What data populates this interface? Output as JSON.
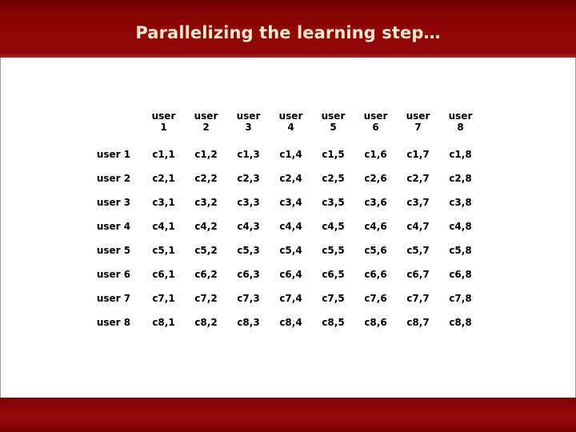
{
  "slide": {
    "title": "Parallelizing the learning step…",
    "title_band_color": "#8b0505",
    "title_text_color": "#fbecd0",
    "body_background": "#ffffff",
    "bottom_band_color": "#8b0505",
    "text_color": "#000000"
  },
  "matrix": {
    "corner_label": "",
    "column_headers": [
      {
        "word": "user",
        "num": "1",
        "label": "user 1"
      },
      {
        "word": "user",
        "num": "2",
        "label": "user 2"
      },
      {
        "word": "user",
        "num": "3",
        "label": "user 3"
      },
      {
        "word": "user",
        "num": "4",
        "label": "user 4"
      },
      {
        "word": "user",
        "num": "5",
        "label": "user 5"
      },
      {
        "word": "user",
        "num": "6",
        "label": "user 6"
      },
      {
        "word": "user",
        "num": "7",
        "label": "user 7"
      },
      {
        "word": "user",
        "num": "8",
        "label": "user 8"
      }
    ],
    "row_headers": [
      "user 1",
      "user 2",
      "user 3",
      "user 4",
      "user 5",
      "user 6",
      "user 7",
      "user 8"
    ],
    "rows": [
      [
        "c1,1",
        "c1,2",
        "c1,3",
        "c1,4",
        "c1,5",
        "c1,6",
        "c1,7",
        "c1,8"
      ],
      [
        "c2,1",
        "c2,2",
        "c2,3",
        "c2,4",
        "c2,5",
        "c2,6",
        "c2,7",
        "c2,8"
      ],
      [
        "c3,1",
        "c3,2",
        "c3,3",
        "c3,4",
        "c3,5",
        "c3,6",
        "c3,7",
        "c3,8"
      ],
      [
        "c4,1",
        "c4,2",
        "c4,3",
        "c4,4",
        "c4,5",
        "c4,6",
        "c4,7",
        "c4,8"
      ],
      [
        "c5,1",
        "c5,2",
        "c5,3",
        "c5,4",
        "c5,5",
        "c5,6",
        "c5,7",
        "c5,8"
      ],
      [
        "c6,1",
        "c6,2",
        "c6,3",
        "c6,4",
        "c6,5",
        "c6,6",
        "c6,7",
        "c6,8"
      ],
      [
        "c7,1",
        "c7,2",
        "c7,3",
        "c7,4",
        "c7,5",
        "c7,6",
        "c7,7",
        "c7,8"
      ],
      [
        "c8,1",
        "c8,2",
        "c8,3",
        "c8,4",
        "c8,5",
        "c8,6",
        "c8,7",
        "c8,8"
      ]
    ]
  }
}
